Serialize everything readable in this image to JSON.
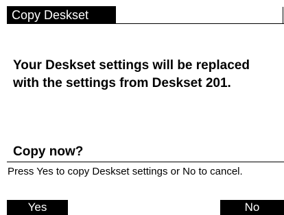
{
  "dialog": {
    "title": "Copy Deskset",
    "message": "Your Deskset settings will be replaced with the settings from Deskset 201.",
    "question": "Copy now?",
    "help_text": "Press Yes to copy Deskset settings or No to cancel."
  },
  "softkeys": {
    "yes_label": "Yes",
    "no_label": "No"
  },
  "colors": {
    "background": "#ffffff",
    "foreground": "#000000",
    "inverse_text": "#ffffff"
  }
}
